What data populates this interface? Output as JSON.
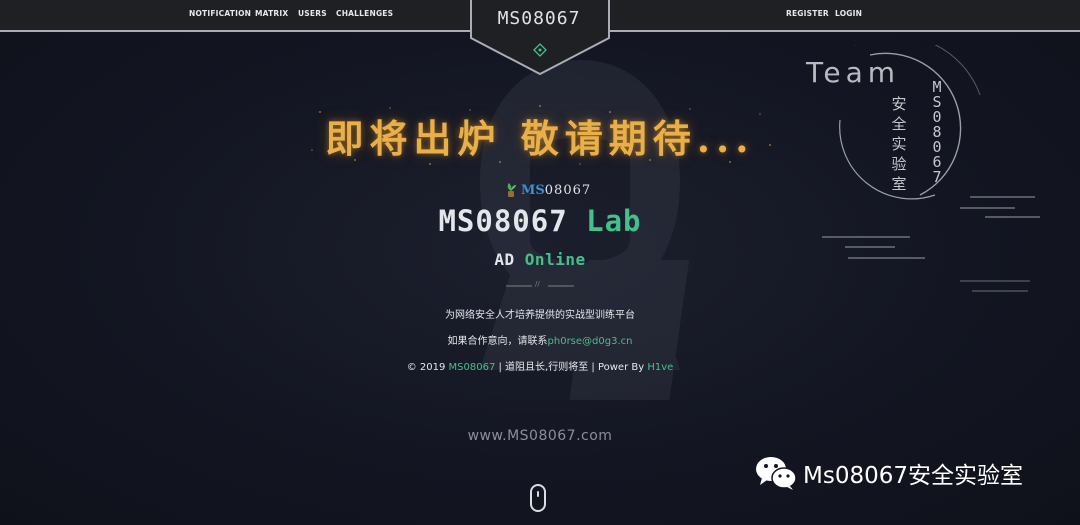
{
  "nav": {
    "left": [
      "NOTIFICATION",
      "MATRIX",
      "USERS",
      "CHALLENGES"
    ],
    "right": [
      "REGISTER",
      "LOGIN"
    ]
  },
  "badge": {
    "title": "MS08067"
  },
  "headline": "即将出炉 敬请期待...",
  "mini_logo": {
    "part1": "MS",
    "part2": "08067"
  },
  "lab": {
    "white": "MS08067 ",
    "green": "Lab"
  },
  "ad": {
    "white": "AD ",
    "green": "Online"
  },
  "divider_mark": "//",
  "tagline": "为网络安全人才培养提供的实战型训练平台",
  "contact": {
    "prefix": "如果合作意向，请联系",
    "email": "ph0rse@d0g3.cn"
  },
  "footer": {
    "copy": "© 2019 ",
    "brand": "MS08067",
    "middle": " | 道阻且长,行则将至 | Power By ",
    "author": "H1ve"
  },
  "website": "www.MS08067.com",
  "deco": {
    "team": "Team",
    "cn": "安全实验室",
    "ms": "MS08067"
  },
  "watermark": "Ms08067安全实验室",
  "colors": {
    "accent_green": "#45c08a",
    "headline_gold": "#e9b04a",
    "background": "#12141f"
  }
}
